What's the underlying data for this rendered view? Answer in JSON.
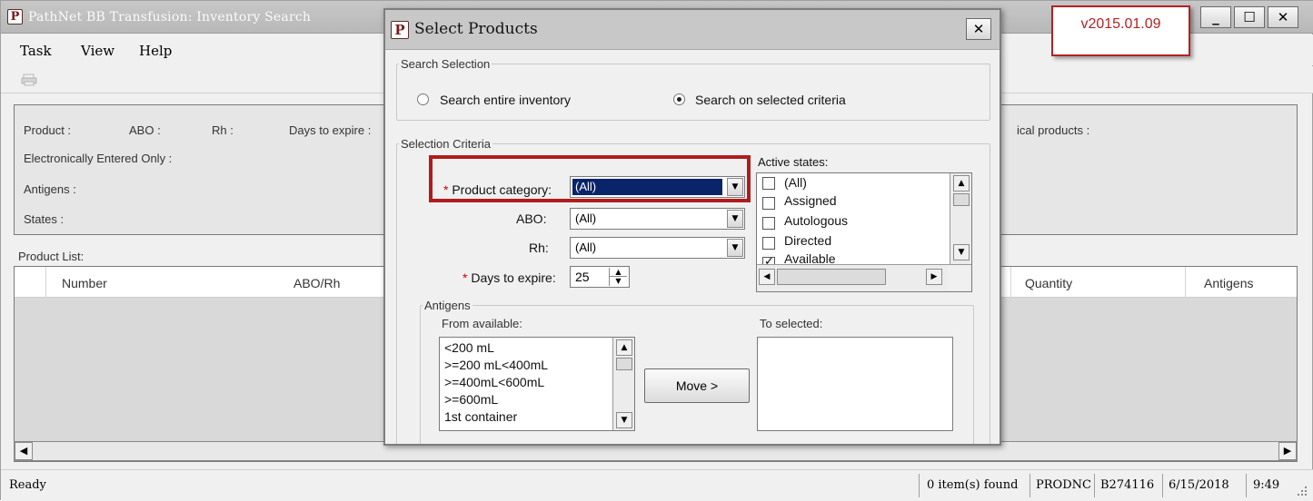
{
  "window": {
    "title": "PathNet BB Transfusion: Inventory Search",
    "app_icon": "P",
    "minimize": "_",
    "maximize": "☐",
    "close": "✕"
  },
  "menu": [
    "Task",
    "View",
    "Help"
  ],
  "toolbar": {
    "icon": "printer-icon"
  },
  "version_callout": "v2015.01.09",
  "criteria": {
    "product": "Product :",
    "abo": "ABO :",
    "rh": "Rh :",
    "days_to_expire": "Days to expire :",
    "electronically_entered_only": "Electronically Entered Only :",
    "antigens": "Antigens :",
    "states": "States :",
    "historical_products_fragment": "ical products :"
  },
  "product_list": {
    "label": "Product List:",
    "columns": [
      "Number",
      "ABO/Rh",
      "Quantity",
      "Antigens"
    ]
  },
  "status_bar": {
    "left": "Ready",
    "items_found": "0 item(s) found",
    "env": "PRODNC",
    "user": "B274116",
    "date": "6/15/2018",
    "time": "9:49"
  },
  "dialog": {
    "title": "Select Products",
    "close": "✕",
    "search_selection": {
      "legend": "Search Selection",
      "options": [
        {
          "label": "Search entire inventory",
          "selected": false
        },
        {
          "label": "Search on selected criteria",
          "selected": true
        }
      ]
    },
    "selection_criteria": {
      "legend": "Selection Criteria",
      "product_category": {
        "label": "Product category:",
        "value": "(All)",
        "required": true
      },
      "abo": {
        "label": "ABO:",
        "value": "(All)"
      },
      "rh": {
        "label": "Rh:",
        "value": "(All)"
      },
      "days_to_expire": {
        "label": "Days to expire:",
        "value": "25",
        "required": true
      },
      "required_mark": "*"
    },
    "active_states": {
      "label": "Active states:",
      "items": [
        {
          "label": "(All)",
          "checked": false
        },
        {
          "label": "Assigned",
          "checked": false
        },
        {
          "label": "Autologous",
          "checked": false
        },
        {
          "label": "Directed",
          "checked": false
        },
        {
          "label": "Available",
          "checked": true
        }
      ]
    },
    "antigens": {
      "legend": "Antigens",
      "from_label": "From available:",
      "to_label": "To selected:",
      "available": [
        "<200 mL",
        ">=200 mL<400mL",
        ">=400mL<600mL",
        ">=600mL",
        "1st container"
      ],
      "selected": [],
      "move_button": "Move >"
    }
  },
  "colors": {
    "highlight": "#b01c1c",
    "selection": "#0a246a",
    "required": "#cc0000"
  }
}
